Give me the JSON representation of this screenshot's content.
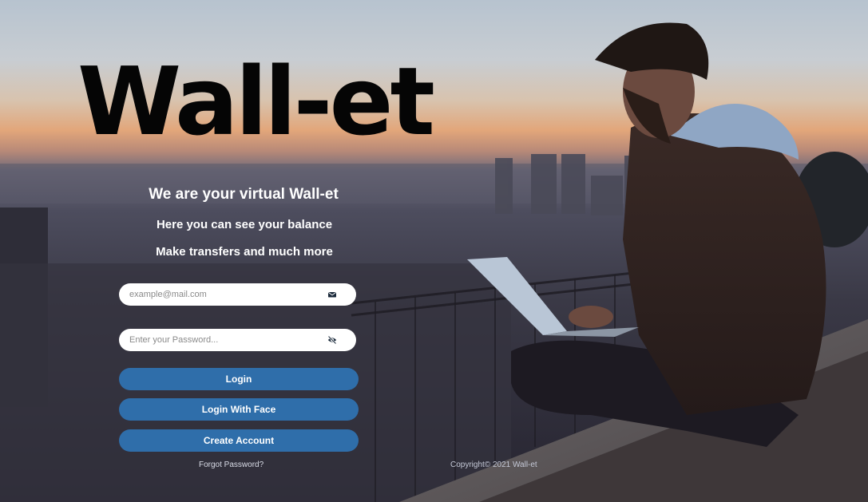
{
  "app": {
    "title": "Wall-et"
  },
  "hero": {
    "heading": "We are your virtual Wall-et",
    "line1": "Here you can see your balance",
    "line2": "Make transfers and much more"
  },
  "form": {
    "email_placeholder": "example@mail.com",
    "email_icon": "envelope-icon",
    "password_placeholder": "Enter your Password...",
    "password_icon": "eye-slash-icon",
    "login_label": "Login",
    "login_face_label": "Login With Face",
    "create_account_label": "Create Account",
    "forgot_label": "Forgot Password?"
  },
  "footer": {
    "copyright": "Copyright© 2021 Wall-et"
  },
  "colors": {
    "button": "#2f6eaa",
    "title": "#050505",
    "text": "#ffffff"
  }
}
